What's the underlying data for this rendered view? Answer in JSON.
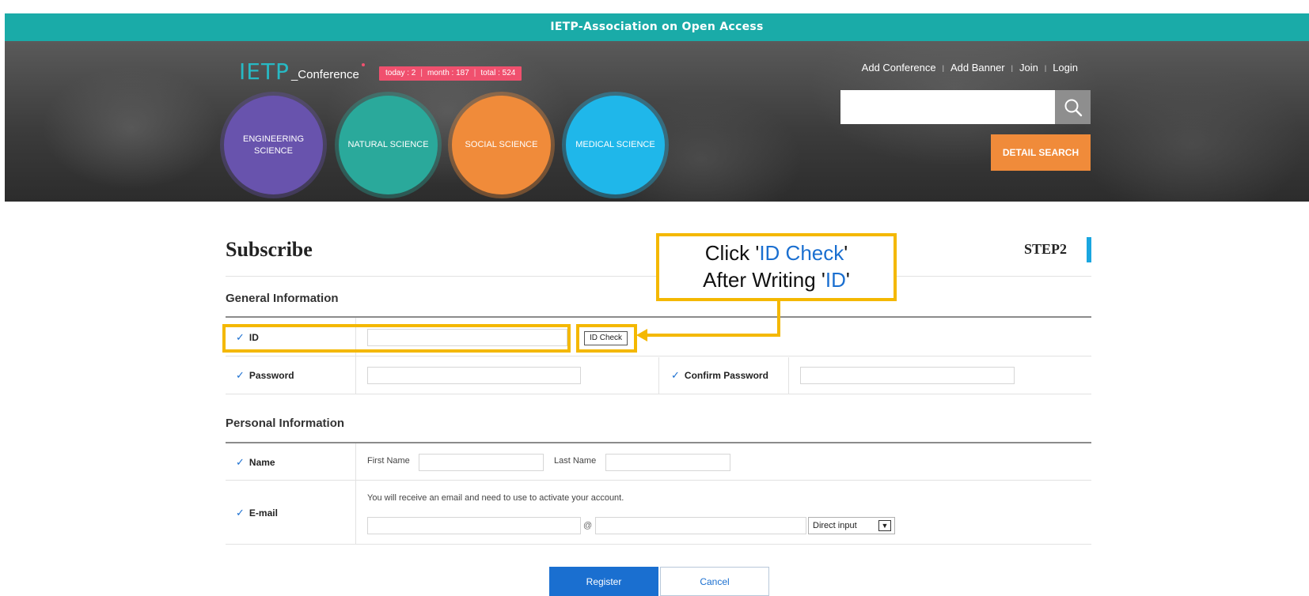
{
  "topbar": {
    "title": "IETP-Association on Open Access"
  },
  "header": {
    "logo": {
      "mark": "IETP",
      "sub": "_Conference"
    },
    "stats": {
      "today": "today : 2",
      "month": "month : 187",
      "total": "total : 524"
    },
    "categories": [
      {
        "label": "ENGINEERING SCIENCE",
        "color": "#6853ad"
      },
      {
        "label": "NATURAL SCIENCE",
        "color": "#2aa99b"
      },
      {
        "label": "SOCIAL SCIENCE",
        "color": "#f08b3a"
      },
      {
        "label": "MEDICAL SCIENCE",
        "color": "#1fb7ea"
      }
    ],
    "links": [
      "Add Conference",
      "Add Banner",
      "Join",
      "Login"
    ],
    "search": {
      "value": "",
      "placeholder": ""
    },
    "detail_search_label": "DETAIL SEARCH"
  },
  "page": {
    "title": "Subscribe",
    "step": "STEP2"
  },
  "general": {
    "title": "General Information",
    "id_label": "ID",
    "id_value": "",
    "id_check_label": "ID Check",
    "password_label": "Password",
    "confirm_password_label": "Confirm Password"
  },
  "personal": {
    "title": "Personal Information",
    "name_label": "Name",
    "first_name_label": "First Name",
    "last_name_label": "Last Name",
    "email_label": "E-mail",
    "email_note": "You will receive an email and need to use to activate your account.",
    "email_at": "@",
    "email_domain_select": "Direct input"
  },
  "actions": {
    "register": "Register",
    "cancel": "Cancel"
  },
  "annotation": {
    "line1_pre": "Click '",
    "line1_hl": "ID Check",
    "line1_post": "'",
    "line2_pre": "After Writing '",
    "line2_hl": "ID",
    "line2_post": "'"
  },
  "colors": {
    "accent_blue": "#1a6fd0",
    "teal": "#1aaba8",
    "highlight": "#f4b800",
    "orange": "#f08b3a"
  }
}
